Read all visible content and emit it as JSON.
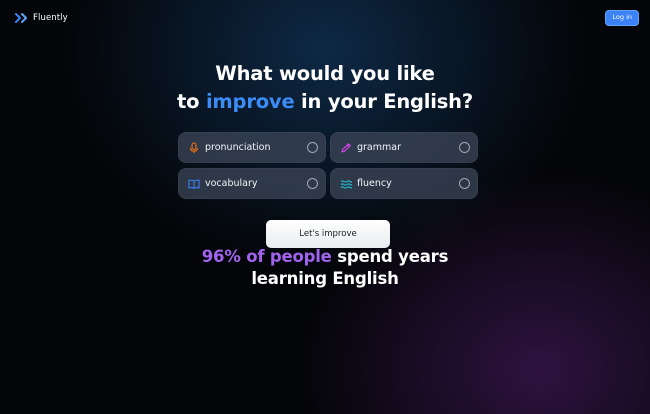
{
  "header": {
    "brand_name": "Fluently",
    "login_label": "Log in"
  },
  "hero": {
    "title_line1": "What would you like",
    "title_prefix": "to ",
    "title_accent": "improve",
    "title_suffix": " in your English?"
  },
  "options": [
    {
      "label": "pronunciation",
      "icon": "microphone-icon",
      "icon_color": "#f97316",
      "selected": false
    },
    {
      "label": "grammar",
      "icon": "pencil-icon",
      "icon_color": "#d946ef",
      "selected": false
    },
    {
      "label": "vocabulary",
      "icon": "book-icon",
      "icon_color": "#3b82f6",
      "selected": false
    },
    {
      "label": "fluency",
      "icon": "waves-icon",
      "icon_color": "#22c3d6",
      "selected": false
    }
  ],
  "cta": {
    "label": "Let's improve"
  },
  "stat": {
    "highlight": "96% of people",
    "rest_line1": " spend years",
    "line2": "learning English"
  },
  "colors": {
    "accent_blue": "#3b8cf5",
    "accent_purple": "#a163f0",
    "login_button": "#3b82f6"
  }
}
